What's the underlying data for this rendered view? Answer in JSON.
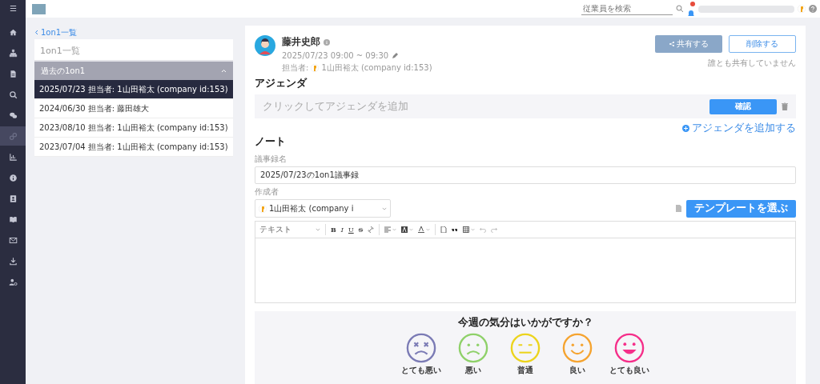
{
  "sidebar": {
    "items": [
      {
        "kind": "menu",
        "selected": false
      },
      {
        "kind": "home",
        "selected": false
      },
      {
        "kind": "org",
        "selected": false
      },
      {
        "kind": "doc",
        "selected": false
      },
      {
        "kind": "search",
        "selected": false
      },
      {
        "kind": "chat",
        "selected": false
      },
      {
        "kind": "link",
        "selected": true
      },
      {
        "kind": "chart",
        "selected": false
      },
      {
        "kind": "info",
        "selected": false
      },
      {
        "kind": "contact",
        "selected": false
      },
      {
        "kind": "book",
        "selected": false
      },
      {
        "kind": "mail",
        "selected": false
      },
      {
        "kind": "download",
        "selected": false
      },
      {
        "kind": "usergear",
        "selected": false
      }
    ]
  },
  "header": {
    "search_placeholder": "従業員を検索"
  },
  "back_link": "1on1一覧",
  "list_panel": {
    "title": "1on1一覧",
    "section": {
      "label": "過去の1on1",
      "expanded": true
    },
    "items": [
      {
        "label": "2025/07/23 担当者: 1山田裕太 (company id:153)",
        "selected": true
      },
      {
        "label": "2024/06/30 担当者: 藤田雄大",
        "selected": false
      },
      {
        "label": "2023/08/10 担当者: 1山田裕太 (company id:153)",
        "selected": false
      },
      {
        "label": "2023/07/04 担当者: 1山田裕太 (company id:153)",
        "selected": false
      }
    ]
  },
  "meeting": {
    "name": "藤井史郎",
    "datetime": "2025/07/23 09:00 ~ 09:30",
    "owner_label": "担当者:",
    "owner": "1山田裕太 (company id:153)",
    "share_button": "共有する",
    "delete_button": "削除する",
    "share_status": "誰とも共有していません"
  },
  "agenda": {
    "heading": "アジェンダ",
    "placeholder": "クリックしてアジェンダを追加",
    "confirm_button": "確認",
    "add_link": "アジェンダを追加する"
  },
  "note": {
    "heading": "ノート",
    "title_label": "議事録名",
    "title_value": "2025/07/23の1on1議事録",
    "author_label": "作成者",
    "author": "1山田裕太 (company i",
    "template_button": "テンプレートを選ぶ",
    "toolbar": [
      {
        "kind": "select",
        "label": "テキスト"
      },
      {
        "kind": "sep"
      },
      {
        "kind": "bold",
        "label": "B"
      },
      {
        "kind": "italic",
        "label": "I"
      },
      {
        "kind": "underline",
        "label": "U"
      },
      {
        "kind": "strike",
        "label": "S"
      },
      {
        "kind": "link"
      },
      {
        "kind": "sep"
      },
      {
        "kind": "align"
      },
      {
        "kind": "highlight"
      },
      {
        "kind": "fontcolor"
      },
      {
        "kind": "sep"
      },
      {
        "kind": "file"
      },
      {
        "kind": "quote"
      },
      {
        "kind": "table"
      },
      {
        "kind": "undo"
      },
      {
        "kind": "redo"
      }
    ]
  },
  "mood": {
    "question": "今週の気分はいかがですか？",
    "options": [
      {
        "kind": "very_bad",
        "label": "とても悪い",
        "color": "#7b7bb5"
      },
      {
        "kind": "bad",
        "label": "悪い",
        "color": "#8fd16a"
      },
      {
        "kind": "neutral",
        "label": "普通",
        "color": "#ecd41e"
      },
      {
        "kind": "good",
        "label": "良い",
        "color": "#f5a431"
      },
      {
        "kind": "very_good",
        "label": "とても良い",
        "color": "#f52f8a"
      }
    ]
  }
}
